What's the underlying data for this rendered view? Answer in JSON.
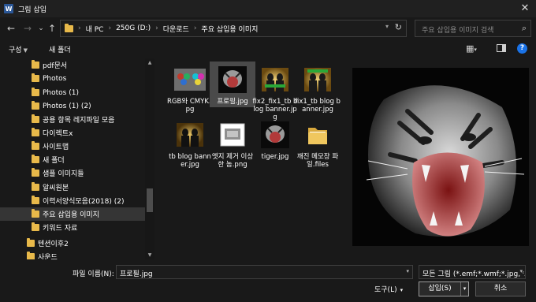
{
  "window": {
    "title": "그림 삽입",
    "app_icon": "W",
    "close_glyph": "✕"
  },
  "nav": {
    "back": "←",
    "forward": "→",
    "history": "⌄",
    "up": "↑",
    "breadcrumb": [
      "내 PC",
      "250G (D:)",
      "다운로드",
      "주요 삽입용 이미지"
    ],
    "search_placeholder": "주요 삽입용 이미지 검색"
  },
  "toolbar": {
    "organize": "구성",
    "new_folder": "새 폴더"
  },
  "sidebar": {
    "items": [
      {
        "label": "pdf문서"
      },
      {
        "label": "Photos"
      },
      {
        "label": "Photos (1)"
      },
      {
        "label": "Photos (1) (2)"
      },
      {
        "label": "공용 항목 레지파일 모음"
      },
      {
        "label": "다이렉트x"
      },
      {
        "label": "사이트맵"
      },
      {
        "label": "새 폴더"
      },
      {
        "label": "샘플 이미지들"
      },
      {
        "label": "알씨원본"
      },
      {
        "label": "이력서양식모음(2018) (2)"
      },
      {
        "label": "주요 삽입용 이미지",
        "selected": true
      },
      {
        "label": "키워드 자료"
      },
      {
        "label": "텐션이후2"
      },
      {
        "label": "사운드"
      }
    ]
  },
  "files": [
    {
      "name": "RGB와 CMYK.jpg",
      "kind": "rgb"
    },
    {
      "name": "프로필.jpg",
      "kind": "tiger",
      "selected": true
    },
    {
      "name": "fix2_fix1_tb blog banner.jpg",
      "kind": "banner"
    },
    {
      "name": "fix1_tb blog banner.jpg",
      "kind": "banner"
    },
    {
      "name": "tb blog banner.jpg",
      "kind": "banner-dark"
    },
    {
      "name": "엣지 제거 이상한 놈.png",
      "kind": "doc"
    },
    {
      "name": "tiger.jpg",
      "kind": "tiger"
    },
    {
      "name": "깨진 메모장 파일.files",
      "kind": "folder"
    }
  ],
  "bottom": {
    "filename_label": "파일 이름(N):",
    "filename_value": "프로필.jpg",
    "filetype_value": "모든 그림 (*.emf;*.wmf;*.jpg;*.jpeg;*.jfif;*.jpe;*.png;*.bmp;*.dib;*.rle;*.gif)",
    "tools_label": "도구(L)",
    "insert_label": "삽입(S)",
    "cancel_label": "취소"
  },
  "colors": {
    "background": "#191919",
    "folder": "#e8b94a",
    "help": "#1a73e8",
    "selection": "#353535"
  }
}
